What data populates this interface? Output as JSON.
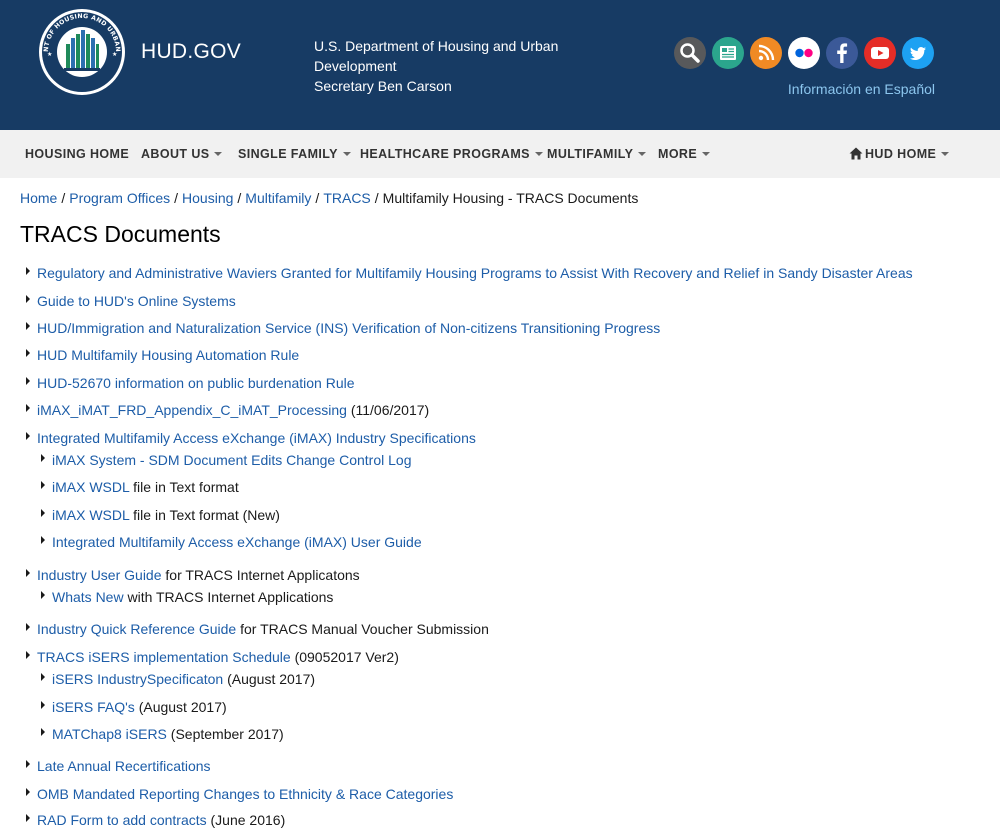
{
  "header": {
    "seal_text": "U.S. DEPARTMENT OF HOUSING AND URBAN DEVELOPMENT",
    "site_name": "HUD.GOV",
    "dept_line1": "U.S. Department of Housing and Urban Development",
    "dept_line2": "Secretary Ben Carson",
    "spanish_link": "Información en Español",
    "social_icons": [
      "search-icon",
      "email-icon",
      "rss-icon",
      "flickr-icon",
      "facebook-icon",
      "youtube-icon",
      "twitter-icon"
    ],
    "colors": {
      "bg": "#173b64",
      "spanish_link": "#8cc6ee"
    }
  },
  "nav": {
    "items": [
      "HOUSING HOME",
      "ABOUT US",
      "SINGLE FAMILY",
      "HEALTHCARE PROGRAMS",
      "MULTIFAMILY",
      "MORE"
    ],
    "right_item": "HUD HOME"
  },
  "breadcrumb": {
    "links": [
      "Home",
      "Program Offices",
      "Housing",
      "Multifamily",
      "TRACS"
    ],
    "current": "Multifamily Housing - TRACS Documents"
  },
  "page_title": "TRACS Documents",
  "documents": [
    {
      "link": "Regulatory and Administrative Waviers Granted for Multifamily Housing Programs to Assist With Recovery and Relief in Sandy Disaster Areas",
      "suffix": ""
    },
    {
      "link": "Guide to HUD's Online Systems",
      "suffix": ""
    },
    {
      "link": "HUD/Immigration and Naturalization Service (INS) Verification of Non-citizens Transitioning Progress",
      "suffix": ""
    },
    {
      "link": "HUD Multifamily Housing Automation Rule",
      "suffix": ""
    },
    {
      "link": "HUD-52670 information on public burdenation Rule",
      "suffix": ""
    },
    {
      "link": "iMAX_iMAT_FRD_Appendix_C_iMAT_Processing",
      "suffix": "(11/06/2017)"
    },
    {
      "link": "Integrated Multifamily Access eXchange (iMAX) Industry Specifications",
      "suffix": ""
    },
    {
      "link": "iMAX System - SDM Document Edits Change Control Log",
      "suffix": ""
    },
    {
      "link": "iMAX WSDL",
      "suffix": "file in Text format"
    },
    {
      "link": "iMAX WSDL",
      "suffix": "file in Text format (New)"
    },
    {
      "link": "Integrated Multifamily Access eXchange (iMAX) User Guide",
      "suffix": ""
    },
    {
      "link": "Industry User Guide",
      "suffix": "for TRACS Internet Applicatons"
    },
    {
      "link": "Whats New",
      "suffix": "with TRACS Internet Applications"
    },
    {
      "link": "Industry Quick Reference Guide",
      "suffix": "for TRACS Manual Voucher Submission"
    },
    {
      "link": "TRACS iSERS implementation Schedule",
      "suffix": "(09052017 Ver2)"
    },
    {
      "link": "iSERS IndustrySpecificaton",
      "suffix": "(August 2017)"
    },
    {
      "link": "iSERS FAQ's",
      "suffix": "(August 2017)"
    },
    {
      "link": "MATChap8 iSERS",
      "suffix": "(September 2017)"
    },
    {
      "link": "Late Annual Recertifications",
      "suffix": ""
    },
    {
      "link": "OMB Mandated Reporting Changes to Ethnicity & Race Categories",
      "suffix": ""
    },
    {
      "link": "RAD Form to add contracts",
      "suffix": "(June 2016)"
    }
  ]
}
